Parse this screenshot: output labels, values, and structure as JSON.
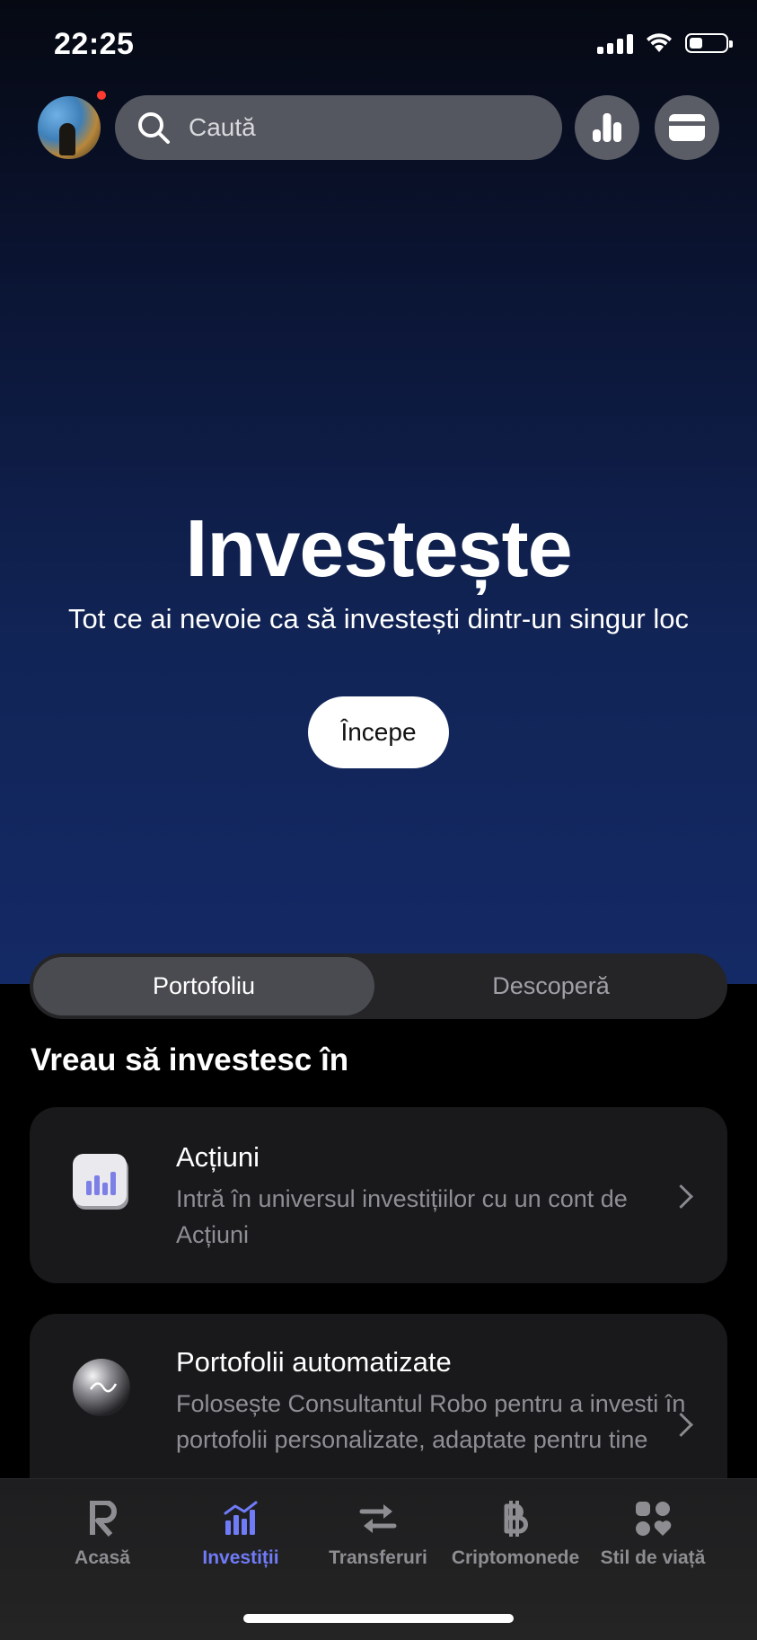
{
  "status_bar": {
    "time": "22:25"
  },
  "top_bar": {
    "search_placeholder": "Caută"
  },
  "hero": {
    "title": "Investește",
    "subtitle": "Tot ce ai nevoie ca să investești dintr-un singur loc",
    "cta": "Începe"
  },
  "tabs": [
    {
      "label": "Portofoliu",
      "active": true
    },
    {
      "label": "Descoperă",
      "active": false
    }
  ],
  "section_title": "Vreau să investesc în",
  "cards": [
    {
      "title": "Acțiuni",
      "description": "Intră în universul investițiilor cu un cont de Acțiuni",
      "icon": "stocks-chart-icon"
    },
    {
      "title": "Portofolii automatizate",
      "description": "Folosește Consultantul Robo pentru a investi în portofolii personalizate, adaptate pentru tine",
      "icon": "robo-advisor-sphere-icon"
    }
  ],
  "bottom_nav": [
    {
      "label": "Acasă",
      "icon": "revolut-r-icon",
      "active": false
    },
    {
      "label": "Investiții",
      "icon": "investments-chart-icon",
      "active": true
    },
    {
      "label": "Transferuri",
      "icon": "transfer-arrows-icon",
      "active": false
    },
    {
      "label": "Criptomonede",
      "icon": "bitcoin-icon",
      "active": false
    },
    {
      "label": "Stil de viață",
      "icon": "lifestyle-shapes-icon",
      "active": false
    }
  ],
  "colors": {
    "accent": "#6f7bf7",
    "notification": "#ff3b30",
    "card_bg": "#19191b"
  }
}
